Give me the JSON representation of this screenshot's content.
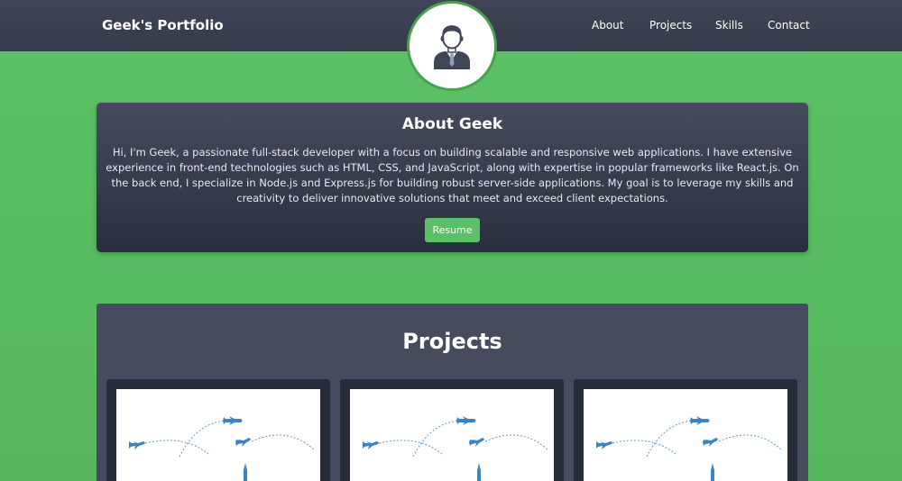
{
  "header": {
    "brand": "Geek's Portfolio",
    "nav": [
      "About",
      "Projects",
      "Skills",
      "Contact"
    ]
  },
  "avatar": {
    "icon": "user-avatar-icon"
  },
  "about": {
    "title": "About Geek",
    "text": "Hi, I'm Geek, a passionate full-stack developer with a focus on building scalable and responsive web applications. I have extensive experience in front-end technologies such as HTML, CSS, and JavaScript, along with expertise in popular frameworks like React.js. On the back end, I specialize in Node.js and Express.js for building robust server-side applications. My goal is to leverage my skills and creativity to deliver innovative solutions that meet and exceed client expectations.",
    "resume_label": "Resume"
  },
  "projects": {
    "title": "Projects",
    "items": [
      {
        "image_icon": "travel-planes-illustration"
      },
      {
        "image_icon": "travel-planes-illustration"
      },
      {
        "image_icon": "travel-planes-illustration"
      }
    ]
  },
  "colors": {
    "background": "#5cc266",
    "navbar": "#3f4556",
    "card_dark": "#2a2f3d",
    "accent_green": "#5ebf69",
    "illustration_blue": "#3b84c4"
  }
}
